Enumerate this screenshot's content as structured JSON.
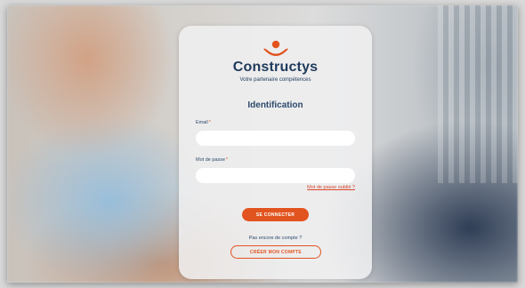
{
  "brand": {
    "name": "Constructys",
    "tagline": "Votre partenaire compétences",
    "accent_color": "#e2541f",
    "text_color": "#1f3a5c"
  },
  "form": {
    "title": "Identification",
    "email_label": "Email",
    "password_label": "Mot de passe",
    "required_marker": "*",
    "email_value": "",
    "password_value": "",
    "forgot_password_link": "Mot de passe oublié ?",
    "login_button": "SE CONNECTER",
    "no_account_text": "Pas encore de compte ?",
    "create_account_button": "CRÉER MON COMPTE"
  },
  "icons": {
    "logo": "people-figure-logo-icon"
  }
}
